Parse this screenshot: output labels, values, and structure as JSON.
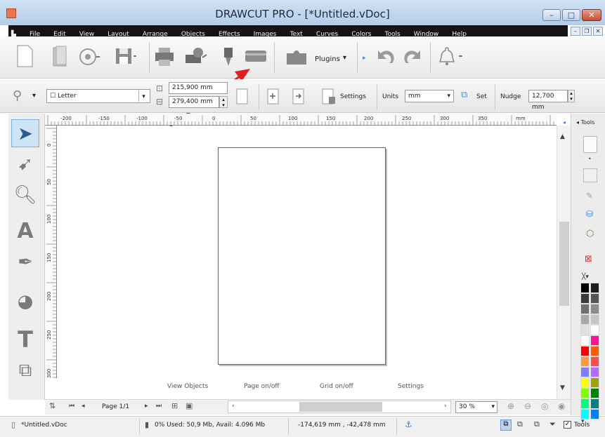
{
  "window": {
    "title": "DRAWCUT PRO - [*Untitled.vDoc]",
    "min": "–",
    "max": "□",
    "close": "✕"
  },
  "menu": [
    "File",
    "Edit",
    "View",
    "Layout",
    "Arrange",
    "Objects",
    "Effects",
    "Images",
    "Text",
    "Curves",
    "Colors",
    "Tools",
    "Window",
    "Help"
  ],
  "mdi": {
    "min": "–",
    "restore": "❐",
    "close": "✕"
  },
  "toolbar1": {
    "plugins_label": "Plugins"
  },
  "toolbar2": {
    "page_size": "Letter",
    "width": "215,900 mm",
    "height": "279,400 mm",
    "settings_label": "Settings",
    "units_label": "Units",
    "units_value": "mm",
    "set_label": "Set",
    "nudge_label": "Nudge",
    "nudge_value": "12,700 mm"
  },
  "ruler": {
    "top_ticks": [
      "-200",
      "-150",
      "-100",
      "-50",
      "0",
      "50",
      "100",
      "150",
      "200",
      "250",
      "300",
      "350",
      "mm"
    ],
    "left_ticks": [
      "0",
      "50",
      "100",
      "150",
      "200",
      "250",
      "300"
    ]
  },
  "hints": {
    "view_objects": "View Objects",
    "page_onoff": "Page on/off",
    "grid_onoff": "Grid on/off",
    "settings": "Settings"
  },
  "nav": {
    "page": "Page 1/1",
    "zoom": "30 %"
  },
  "status": {
    "file": "*Untitled.vDoc",
    "memory": "0%  Used: 50,9 Mb, Avail: 4.096 Mb",
    "coords": "-174,619 mm , -42,478 mm",
    "tools": "Tools"
  },
  "panel": {
    "header": "Tools"
  },
  "colors": {
    "accent": "#4a90d9",
    "arrow": "#e02020",
    "palette": [
      "#000000",
      "#1c1c1c",
      "#3a3a3a",
      "#555555",
      "#707070",
      "#8c8c8c",
      "#a8a8a8",
      "#c4c4c4",
      "#e0e0e0",
      "#ffffff",
      "#ffffff",
      "#ff1493",
      "#ff0000",
      "#ff5a00",
      "#ff9a3c",
      "#ff4d4d",
      "#8080ff",
      "#b36bff",
      "#ffff00",
      "#a0a000",
      "#80ff00",
      "#008000",
      "#00ff80",
      "#008080",
      "#00ffff",
      "#0080ff"
    ]
  }
}
